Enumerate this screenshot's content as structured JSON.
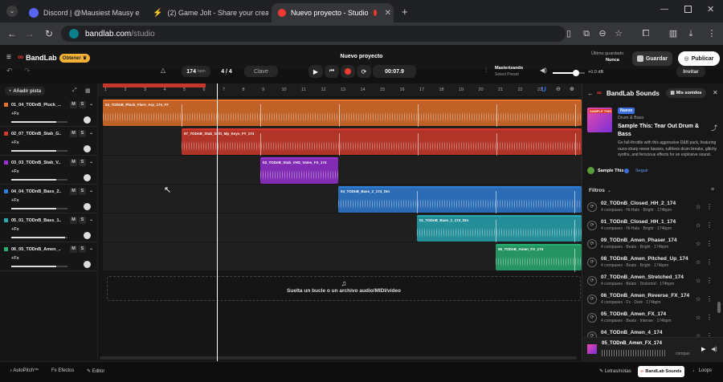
{
  "browser": {
    "tabs": [
      {
        "label": "Discord | @Mausiest Mausy e",
        "color": "#5865f2"
      },
      {
        "label": "(2) Game Jolt - Share your creat",
        "color": "#ffffff"
      },
      {
        "label": "Nuevo proyecto - Studio",
        "color": "#f23a30"
      }
    ],
    "url_host": "bandlab.com",
    "url_path": "/studio"
  },
  "app": {
    "logo": "BandLab",
    "get_button": "Obtener",
    "project_title": "Nuevo proyecto",
    "saved_label": "Último guardado",
    "saved_value": "Nunca",
    "save_button": "Guardar",
    "publish_button": "Publicar",
    "invite_button": "Invitar",
    "add_track": "Añadir pista",
    "bpm_value": "174",
    "bpm_unit": "bpm",
    "time_sig": "4 / 4",
    "key_button": "Clave",
    "time_display": "00:07.9",
    "mastering_label": "Masterizando",
    "mastering_sub": "Select Preset",
    "volume_db": "+0.0 dB"
  },
  "ruler": [
    "1",
    "2",
    "3",
    "4",
    "5",
    "6",
    "7",
    "8",
    "9",
    "10",
    "11",
    "12",
    "13",
    "14",
    "15",
    "16",
    "17",
    "18",
    "19",
    "20",
    "21",
    "22",
    "23"
  ],
  "tracks": [
    {
      "name": "01_04_TODnB_Pluck_...",
      "fx": "+Fx",
      "color": "#e8732a",
      "clip": "04_TODnB_Pluck_Flare_Arp_174_F#",
      "clip_start": 0,
      "clip_len": 596,
      "slider": 0.8
    },
    {
      "name": "02_07_TODnB_Stab_G...",
      "fx": "+Fx",
      "color": "#d6392b",
      "clip": "07_TODnB_Stab_Gritt_Mp_Keys_F#_174",
      "clip_start": 98,
      "clip_len": 498,
      "slider": 0.8
    },
    {
      "name": "03_03_TODnB_Stab_V...",
      "fx": "+Fx",
      "color": "#9b2fd8",
      "clip": "03_TODnB_Stab_VHS_Vates_FX_174",
      "clip_start": 196,
      "clip_len": 97,
      "slider": 0.8
    },
    {
      "name": "04_04_TODnB_Bass_2...",
      "fx": "+Fx",
      "color": "#2e7fd9",
      "clip": "04_TODnB_Bass_2_174_Dm",
      "clip_start": 293,
      "clip_len": 303,
      "slider": 0.8
    },
    {
      "name": "05_01_TODnB_Bass_1...",
      "fx": "+Fx",
      "color": "#27aab6",
      "clip": "01_TODnB_Bass_1_174_Dm",
      "clip_start": 391,
      "clip_len": 205,
      "slider": 0.95
    },
    {
      "name": "06_05_TODnB_Amen_...",
      "fx": "+Fx",
      "color": "#27b073",
      "clip": "05_TODnB_Amen_FX_174",
      "clip_start": 489,
      "clip_len": 107,
      "slider": 0.8
    }
  ],
  "drop_text": "Suelta un bucle o un archivo audio/MIDI/vídeo",
  "sounds": {
    "title": "BandLab Sounds",
    "my_sounds": "Mis sonidos",
    "pack_badge": "Nuevo",
    "pack_genre": "Drum & Bass",
    "pack_title": "Sample This: Tear Out Drum & Bass",
    "pack_desc": "Go full-throttle with this aggressive D&B pack, featuring razor-sharp reese basses, ruthless drum breaks, glitchy synths, and ferocious effects for an explosive sound.",
    "author": "Sample This",
    "follow": "Seguir",
    "filters": "Filtros",
    "items": [
      {
        "name": "02_TODnB_Closed_HH_2_174",
        "meta": "4 compases · Hi-Hats · Bright · 174bpm"
      },
      {
        "name": "01_TODnB_Closed_HH_1_174",
        "meta": "4 compases · Hi-Hats · Bright · 174bpm"
      },
      {
        "name": "09_TODnB_Amen_Phaser_174",
        "meta": "4 compases · Beats · Bright · 174bpm"
      },
      {
        "name": "08_TODnB_Amen_Pitched_Up_174",
        "meta": "4 compases · Beats · Bright · 174bpm"
      },
      {
        "name": "07_TODnB_Amen_Stretched_174",
        "meta": "4 compases · Beats · Distorted · 174bpm"
      },
      {
        "name": "06_TODnB_Amen_Reverse_FX_174",
        "meta": "4 compases · Fx · Dark · 174bpm"
      },
      {
        "name": "05_TODnB_Amen_FX_174",
        "meta": "4 compases · Beats · Intense · 174bpm"
      },
      {
        "name": "04_TODnB_Amen_4_174",
        "meta": "4 compases · Beats · Bright · 174bpm"
      }
    ],
    "now_playing": "05_TODnB_Amen_FX_174",
    "now_playing_sub": "compas"
  },
  "footer": {
    "autopitch": "AutoPitch™",
    "effects": "Efectos",
    "editor": "Editor",
    "lyrics": "Letras/notas",
    "bandlab_sounds": "BandLab Sounds",
    "loops": "Loops"
  }
}
